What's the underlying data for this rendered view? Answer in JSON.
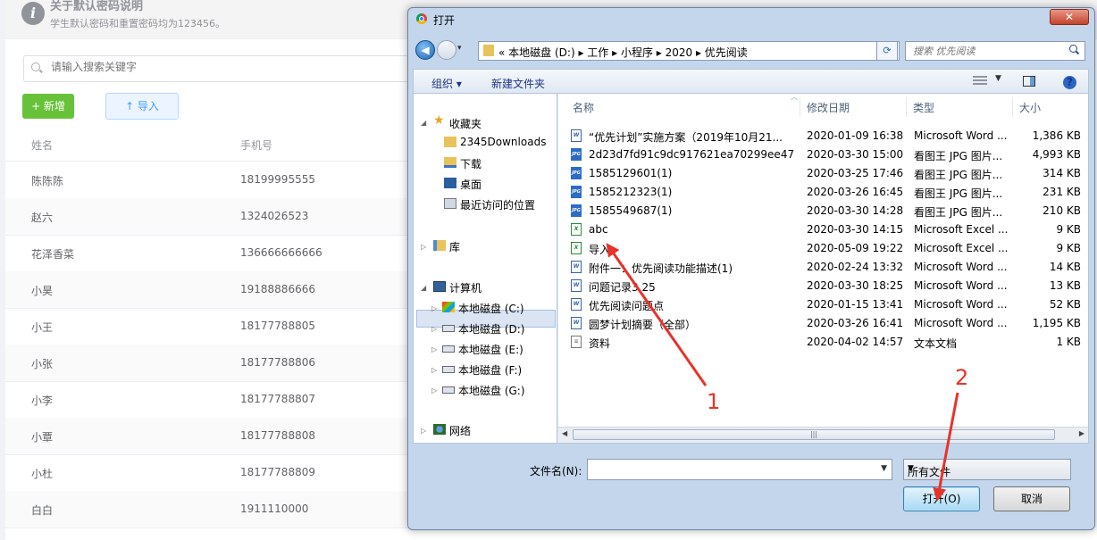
{
  "notice": {
    "title": "关于默认密码说明",
    "text": "学生默认密码和重置密码均为123456。"
  },
  "search": {
    "placeholder": "请输入搜索关键字"
  },
  "buttons": {
    "new_label": "+ 新增",
    "import_label": "↑ 导入"
  },
  "table": {
    "headers": [
      "姓名",
      "手机号"
    ],
    "rows": [
      [
        "陈陈陈",
        "18199995555"
      ],
      [
        "赵六",
        "1324026523"
      ],
      [
        "花泽香菜",
        "136666666666"
      ],
      [
        "小昊",
        "19188886666"
      ],
      [
        "小王",
        "18177788805"
      ],
      [
        "小张",
        "18177788806"
      ],
      [
        "小李",
        "18177788807"
      ],
      [
        "小覃",
        "18177788808"
      ],
      [
        "小杜",
        "18177788809"
      ],
      [
        "白白",
        "1911110000"
      ]
    ]
  },
  "dialog": {
    "title": "打开",
    "close_label": "✕",
    "address": {
      "prefix": "«",
      "crumbs": "本地磁盘 (D:) ▸ 工作 ▸ 小程序 ▸ 2020 ▸ 优先阅读"
    },
    "search_placeholder": "搜索 优先阅读",
    "toolbar": {
      "organize": "组织 ▾",
      "new_folder": "新建文件夹"
    },
    "nav": {
      "favorites": "收藏夹",
      "fav_items": [
        "2345Downloads",
        "下载",
        "桌面",
        "最近访问的位置"
      ],
      "libraries": "库",
      "computer": "计算机",
      "drives": [
        "本地磁盘 (C:)",
        "本地磁盘 (D:)",
        "本地磁盘 (E:)",
        "本地磁盘 (F:)",
        "本地磁盘 (G:)"
      ],
      "network": "网络"
    },
    "columns": [
      "名称",
      "修改日期",
      "类型",
      "大小"
    ],
    "files": [
      {
        "name": "“优先计划”实施方案（2019年10月21...",
        "date": "2020-01-09 16:38",
        "type": "Microsoft Word ...",
        "size": "1,386 KB",
        "icon": "word"
      },
      {
        "name": "2d23d7fd91c9dc917621ea70299ee47",
        "date": "2020-03-30 15:00",
        "type": "看图王 JPG 图片...",
        "size": "4,993 KB",
        "icon": "jpg"
      },
      {
        "name": "1585129601(1)",
        "date": "2020-03-25 17:46",
        "type": "看图王 JPG 图片...",
        "size": "314 KB",
        "icon": "jpg"
      },
      {
        "name": "1585212323(1)",
        "date": "2020-03-26 16:45",
        "type": "看图王 JPG 图片...",
        "size": "231 KB",
        "icon": "jpg"
      },
      {
        "name": "1585549687(1)",
        "date": "2020-03-30 14:28",
        "type": "看图王 JPG 图片...",
        "size": "210 KB",
        "icon": "jpg"
      },
      {
        "name": "abc",
        "date": "2020-03-30 14:15",
        "type": "Microsoft Excel ...",
        "size": "9 KB",
        "icon": "xls"
      },
      {
        "name": "导入",
        "date": "2020-05-09 19:22",
        "type": "Microsoft Excel ...",
        "size": "9 KB",
        "icon": "xls"
      },
      {
        "name": "附件一：优先阅读功能描述(1)",
        "date": "2020-02-24 13:32",
        "type": "Microsoft Word ...",
        "size": "14 KB",
        "icon": "word"
      },
      {
        "name": "问题记录3.25",
        "date": "2020-03-30 18:25",
        "type": "Microsoft Word ...",
        "size": "13 KB",
        "icon": "word"
      },
      {
        "name": "优先阅读问题点",
        "date": "2020-01-15 13:41",
        "type": "Microsoft Word ...",
        "size": "52 KB",
        "icon": "word"
      },
      {
        "name": "圆梦计划摘要（全部）",
        "date": "2020-03-26 16:41",
        "type": "Microsoft Word ...",
        "size": "1,195 KB",
        "icon": "word"
      },
      {
        "name": "资料",
        "date": "2020-04-02 14:57",
        "type": "文本文档",
        "size": "1 KB",
        "icon": "txt"
      }
    ],
    "filename_label": "文件名(N):",
    "filename_value": "",
    "filetype_value": "所有文件",
    "open_label": "打开(O)",
    "cancel_label": "取消"
  },
  "annotations": [
    "1",
    "2"
  ],
  "colors": {
    "annotation": "#e8332a",
    "new_button": "#67c23a",
    "import_button": "#409eff"
  }
}
